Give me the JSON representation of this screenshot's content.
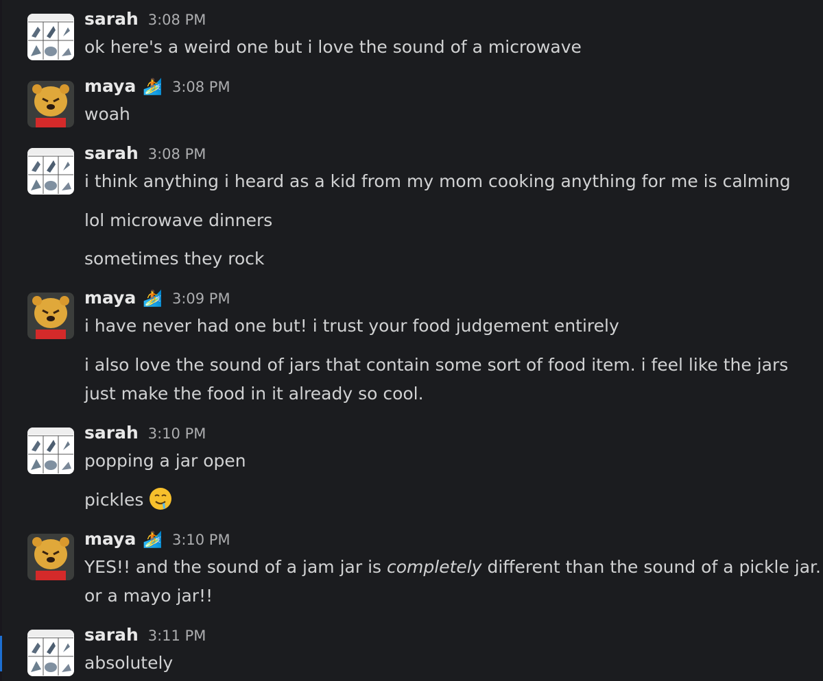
{
  "messages": [
    {
      "user": "sarah",
      "time": "3:08 PM",
      "lines": [
        "ok here's a weird one but i love the sound of a microwave"
      ]
    },
    {
      "user": "maya",
      "status_emoji": "🏄",
      "time": "3:08 PM",
      "lines": [
        "woah"
      ]
    },
    {
      "user": "sarah",
      "time": "3:08 PM",
      "lines": [
        "i think anything i heard as a kid from my mom cooking anything for me is calming",
        "lol microwave dinners",
        "sometimes they rock"
      ]
    },
    {
      "user": "maya",
      "status_emoji": "🏄",
      "time": "3:09 PM",
      "lines": [
        "i have never had one but! i trust your food judgement entirely",
        "i also love the sound of jars that contain some sort of food item. i feel like the jars",
        "just make the food in it already so cool."
      ]
    },
    {
      "user": "sarah",
      "time": "3:10 PM",
      "lines": [
        "popping a jar open",
        "pickles"
      ]
    },
    {
      "user": "maya",
      "status_emoji": "🏄",
      "time": "3:10 PM",
      "lines": {
        "l1_before": "YES!! and the sound of a jam jar is ",
        "l1_em": "completely",
        "l1_after": " different than the sound of a pickle jar.",
        "l2": "or a mayo jar!!"
      }
    },
    {
      "user": "sarah",
      "time": "3:11 PM",
      "lines": [
        "absolutely"
      ]
    }
  ],
  "icons": {
    "sarah_avatar": "captcha-grid-avatar",
    "maya_avatar": "winnie-the-pooh-avatar",
    "status": "surfer-emoji",
    "pickles_reaction": "drooling-face-emoji"
  },
  "colors": {
    "background": "#1b1c1f",
    "text": "#d1d2d3",
    "name": "#e8e8e8",
    "timestamp": "#acadaf",
    "active_marker": "#1d6fd1"
  }
}
